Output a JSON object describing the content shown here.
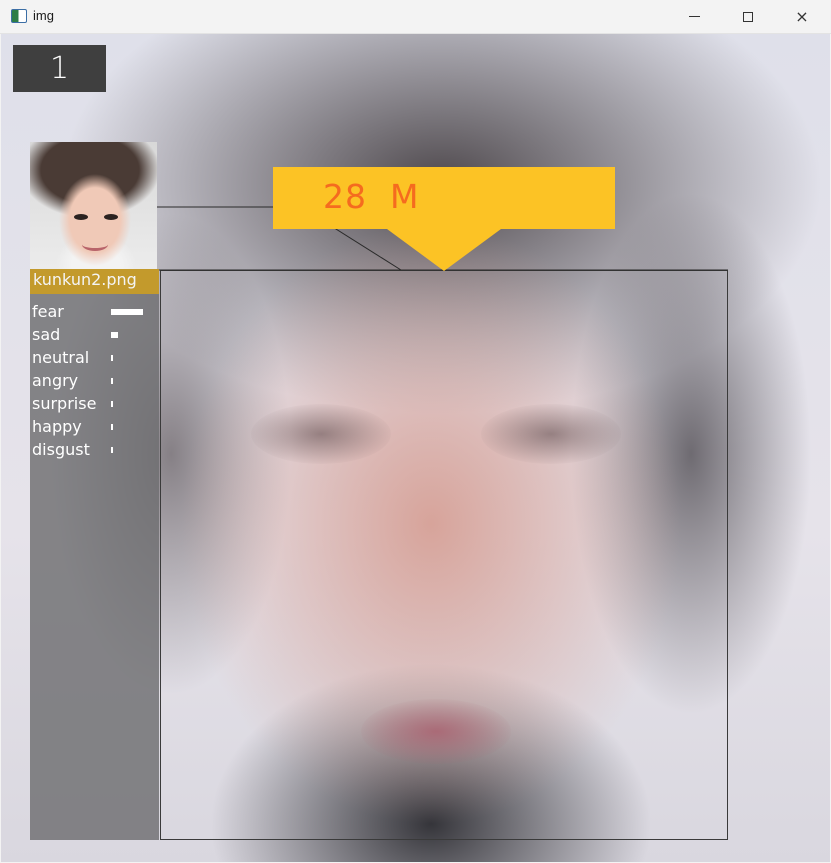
{
  "window": {
    "title": "img",
    "controls": {
      "minimize": "minimize",
      "maximize": "maximize",
      "close": "×"
    }
  },
  "overlay": {
    "frame_counter": "1",
    "label": "28  M",
    "filename": "kunkun2.png",
    "accent_color": "#fcc325",
    "label_text_color": "#f56b1f",
    "filename_bg": "#c39a2c",
    "emotions": [
      {
        "label": "fear",
        "score": 0.22
      },
      {
        "label": "sad",
        "score": 0.05
      },
      {
        "label": "neutral",
        "score": 0.01
      },
      {
        "label": "angry",
        "score": 0.01
      },
      {
        "label": "surprise",
        "score": 0.01
      },
      {
        "label": "happy",
        "score": 0.01
      },
      {
        "label": "disgust",
        "score": 0.01
      }
    ]
  }
}
